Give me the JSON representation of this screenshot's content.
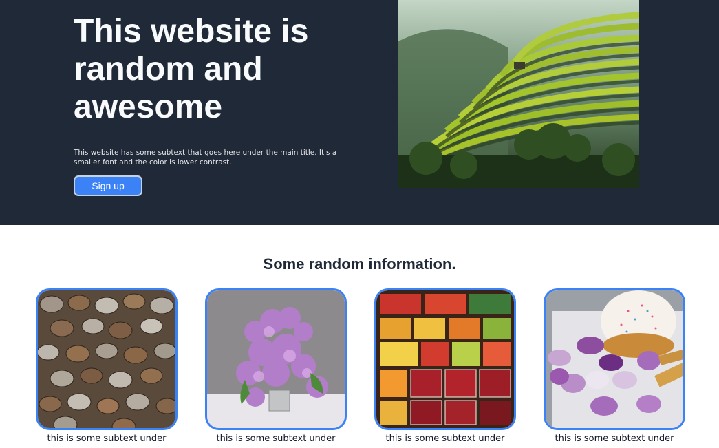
{
  "hero": {
    "title": "This website is random and awesome",
    "subtext": "This website has some subtext that goes here under the main title. It's a smaller font and the color is lower contrast.",
    "signup_label": "Sign up",
    "image": "terraced-rice-fields-photo"
  },
  "info": {
    "title": "Some random information.",
    "cards": [
      {
        "image": "coins-photo",
        "caption": "this is some subtext under"
      },
      {
        "image": "lilac-flowers-photo",
        "caption": "this is some subtext under"
      },
      {
        "image": "fruit-market-photo",
        "caption": "this is some subtext under"
      },
      {
        "image": "easter-eggs-cake-photo",
        "caption": "this is some subtext under"
      }
    ]
  },
  "colors": {
    "hero_bg": "#1f2937",
    "accent": "#3b82f6",
    "page_bg": "#ffffff"
  }
}
